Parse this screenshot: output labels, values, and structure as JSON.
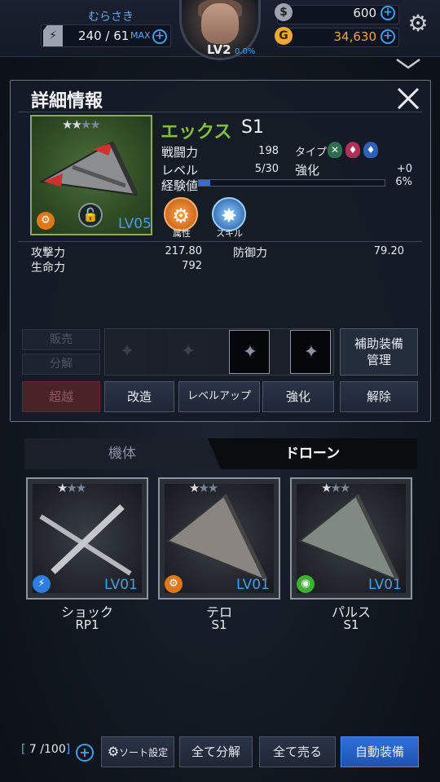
{
  "player": {
    "name": "むらさき",
    "level": "LV2",
    "exp_pct": "0.0%"
  },
  "stamina": {
    "value": "240 / 61",
    "max_label": "MAX"
  },
  "currency": {
    "silver": "600",
    "gold": "34,630"
  },
  "detail": {
    "title": "詳細情報",
    "unit_name": "エックス",
    "unit_grade": "S1",
    "unit_level_badge": "LV05",
    "stars_filled": 2,
    "stars_total": 4,
    "combat_power_label": "戦闘力",
    "combat_power": "198",
    "level_label": "レベル",
    "level": "5/30",
    "exp_label": "経験値",
    "exp_fill_pct": 6,
    "type_label": "タイプ",
    "enhance_label": "強化",
    "enhance_value": "+0",
    "exp_pct_text": "6%",
    "attr_label": "属性",
    "skill_label": "スキル",
    "stats": [
      {
        "label": "攻撃力",
        "value": "217.80"
      },
      {
        "label": "生命力",
        "value": "792"
      },
      {
        "label": "防御力",
        "value": "79.20"
      }
    ],
    "sell_label": "販売",
    "disassemble_label": "分解",
    "support_equip_label_1": "補助装備",
    "support_equip_label_2": "管理",
    "buttons": {
      "transcend": "超越",
      "modify": "改造",
      "level_up": "レベルアップ",
      "enhance": "強化",
      "release": "解除"
    }
  },
  "tabs": {
    "left": "機体",
    "right": "ドローン"
  },
  "drones": [
    {
      "name": "ショック",
      "grade": "RP1",
      "level": "LV01",
      "stars_filled": 1,
      "element": "lightning"
    },
    {
      "name": "テロ",
      "grade": "S1",
      "level": "LV01",
      "stars_filled": 1,
      "element": "gear"
    },
    {
      "name": "パルス",
      "grade": "S1",
      "level": "LV01",
      "stars_filled": 1,
      "element": "pulse"
    }
  ],
  "bottom": {
    "inventory_current": "7",
    "inventory_max": "100",
    "sort_label": "ソート設定",
    "disassemble_all": "全て分解",
    "sell_all": "全て売る",
    "auto_equip": "自動装備"
  },
  "colors": {
    "accent_blue": "#3ea0f0",
    "name_green": "#7fbf3f",
    "gold": "#f0a830"
  }
}
